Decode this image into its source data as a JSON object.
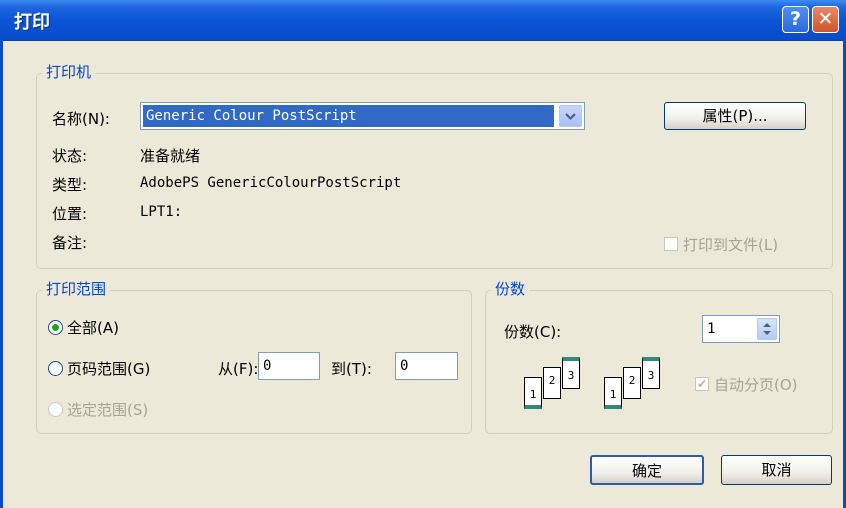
{
  "window": {
    "title": "打印",
    "help": "?",
    "close": "✕"
  },
  "printer_group": {
    "legend": "打印机",
    "name_label": "名称(N):",
    "name_value": "Generic Colour PostScript",
    "properties_button": "属性(P)...",
    "status_label": "状态:",
    "status_value": "准备就绪",
    "type_label": "类型:",
    "type_value": "AdobePS GenericColourPostScript",
    "location_label": "位置:",
    "location_value": "LPT1:",
    "comment_label": "备注:",
    "print_to_file": "打印到文件(L)"
  },
  "range_group": {
    "legend": "打印范围",
    "all": "全部(A)",
    "pages": "页码范围(G)",
    "from_label": "从(F):",
    "from_value": "0",
    "to_label": "到(T):",
    "to_value": "0",
    "selection": "选定范围(S)",
    "selected_option": "all"
  },
  "copies_group": {
    "legend": "份数",
    "copies_label": "份数(C):",
    "copies_value": "1",
    "collate": "自动分页(O)",
    "collate_checked": true,
    "page_numbers": [
      "1",
      "2",
      "3"
    ]
  },
  "buttons": {
    "ok": "确定",
    "cancel": "取消"
  }
}
